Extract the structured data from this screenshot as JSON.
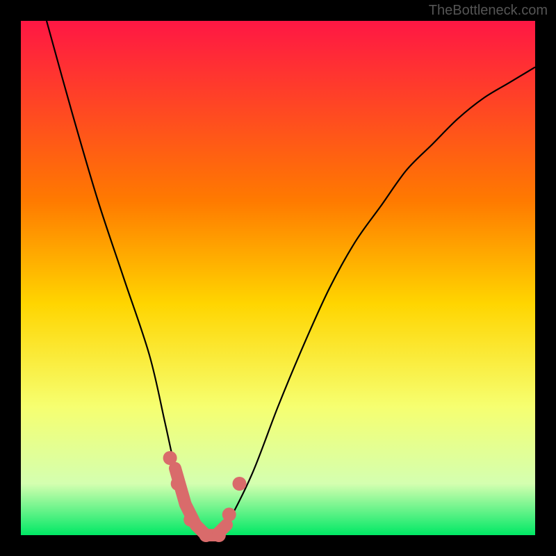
{
  "watermark": "TheBottleneck.com",
  "chart_data": {
    "type": "line",
    "title": "",
    "xlabel": "",
    "ylabel": "",
    "xlim": [
      0,
      100
    ],
    "ylim": [
      0,
      100
    ],
    "background_gradient": {
      "stops": [
        {
          "offset": 0,
          "color": "#ff1744"
        },
        {
          "offset": 35,
          "color": "#ff7a00"
        },
        {
          "offset": 55,
          "color": "#ffd500"
        },
        {
          "offset": 75,
          "color": "#f6ff70"
        },
        {
          "offset": 90,
          "color": "#d4ffb0"
        },
        {
          "offset": 100,
          "color": "#00e865"
        }
      ]
    },
    "series": [
      {
        "name": "bottleneck-curve",
        "x": [
          5,
          10,
          15,
          20,
          25,
          28,
          30,
          32,
          34,
          36,
          38,
          40,
          45,
          50,
          55,
          60,
          65,
          70,
          75,
          80,
          85,
          90,
          95,
          100
        ],
        "y": [
          100,
          82,
          65,
          50,
          35,
          22,
          13,
          6,
          2,
          0,
          0,
          2,
          12,
          25,
          37,
          48,
          57,
          64,
          71,
          76,
          81,
          85,
          88,
          91
        ]
      }
    ],
    "highlight_segment": {
      "name": "optimal-range",
      "color": "#d96b6b",
      "x": [
        30,
        32,
        34,
        36,
        38,
        40
      ],
      "y": [
        13,
        6,
        2,
        0,
        0,
        2
      ],
      "markers_x": [
        29,
        30.5,
        33,
        36,
        38.5,
        40.5,
        42.5
      ],
      "markers_y": [
        15,
        10,
        3,
        0,
        0,
        4,
        10
      ]
    },
    "frame": {
      "color": "#000000",
      "thickness_px": 30
    }
  }
}
